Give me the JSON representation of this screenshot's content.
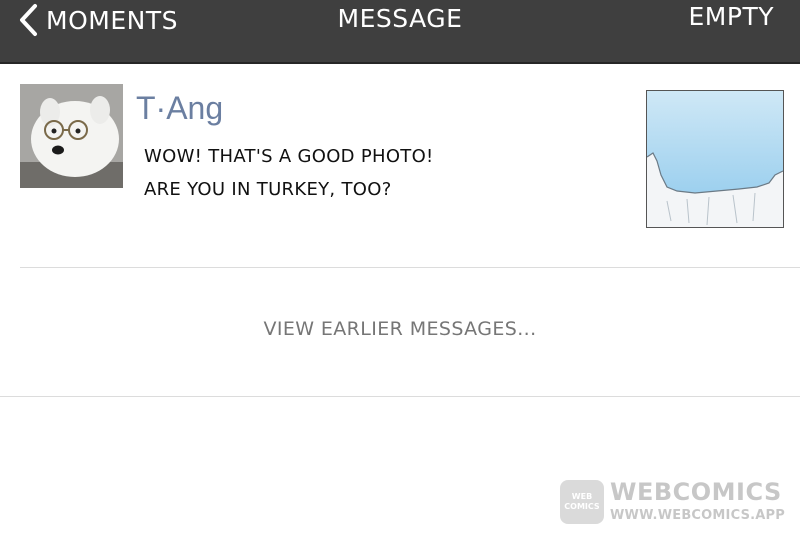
{
  "navbar": {
    "back_label": "MOMENTS",
    "title": "MESSAGE",
    "empty_label": "EMPTY",
    "background_color": "#3f3f3f"
  },
  "message": {
    "sender_name": "T·Ang",
    "sender_name_color": "#6b7fa1",
    "lines": [
      "WOW! THAT'S A GOOD PHOTO!",
      "ARE YOU IN TURKEY, TOO?"
    ],
    "avatar_icon": "dog-with-glasses-avatar",
    "thumbnail_icon": "snowy-landscape-photo"
  },
  "view_earlier_label": "VIEW EARLIER MESSAGES...",
  "watermark": {
    "logo_text": "WEB COMICS",
    "brand": "WEBCOMICS",
    "url": "WWW.WEBCOMICS.APP"
  }
}
